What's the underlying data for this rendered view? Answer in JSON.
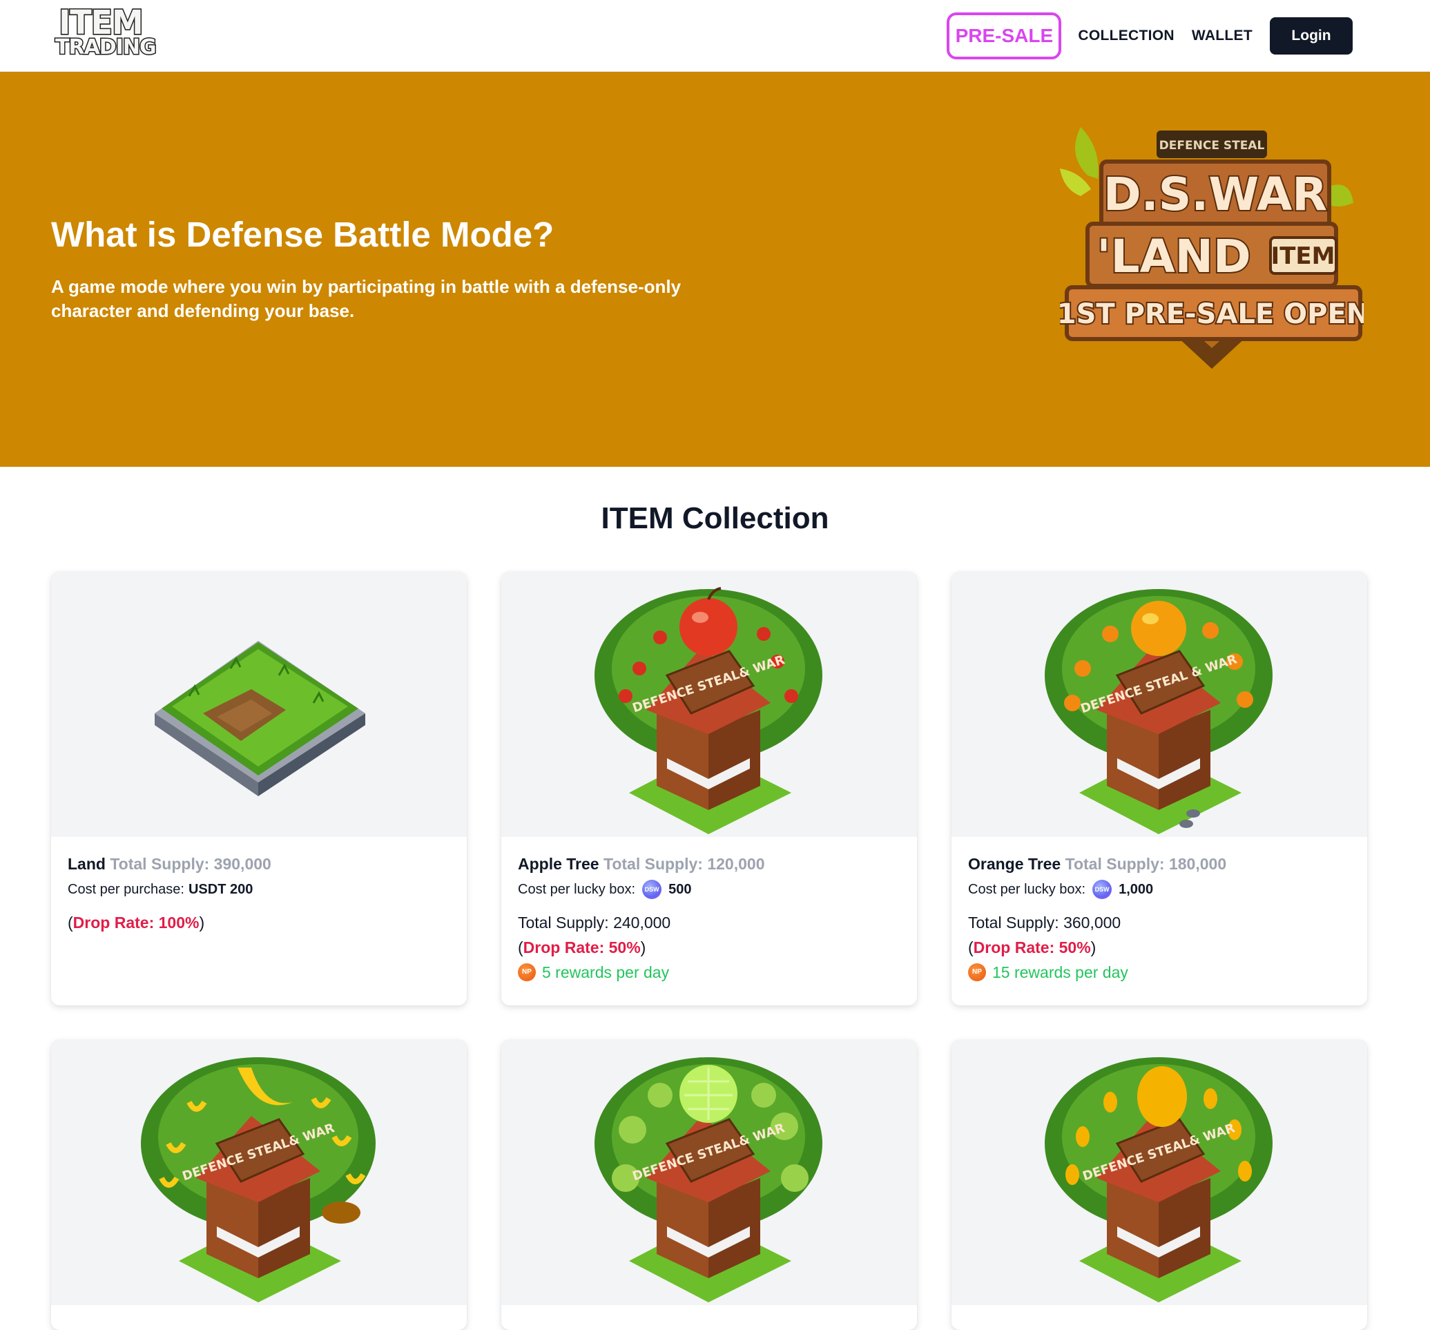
{
  "header": {
    "logo_line1": "ITEM",
    "logo_line2": "TRADING",
    "presale_label": "PRE-SALE",
    "nav_collection": "COLLECTION",
    "nav_wallet": "WALLET",
    "login_label": "Login"
  },
  "hero": {
    "title": "What is Defense Battle Mode?",
    "subtitle": "A game mode where you win by participating in battle with a defense-only character and defending your base.",
    "badge_top": "DEFENCE STEAL",
    "badge_line1": "D.S.WAR",
    "badge_line2": "'LAND",
    "badge_item": "ITEM",
    "badge_line3": "1ST PRE-SALE OPEN",
    "background_color": "#cd8700"
  },
  "collection": {
    "title": "ITEM Collection",
    "cards": [
      {
        "name": "Land",
        "supply": "Total Supply: 390,000",
        "cost_label": "Cost per purchase:",
        "cost_value": "USDT 200",
        "drop_open": "(",
        "drop_text": "Drop Rate: 100%",
        "drop_close": ")",
        "icon": "land-tile-icon"
      },
      {
        "name": "Apple Tree",
        "supply": "Total Supply: 120,000",
        "cost_label": "Cost per lucky box:",
        "coin_label": "DSW",
        "cost_value": "500",
        "total_supply": "Total Supply: 240,000",
        "drop_open": "(",
        "drop_text": "Drop Rate: 50%",
        "drop_close": ")",
        "np_label": "NP",
        "reward": "5 rewards per day",
        "shop_sign": "DEFENCE STEAL& WAR",
        "icon": "apple-tree-shop-icon"
      },
      {
        "name": "Orange Tree",
        "supply": "Total Supply: 180,000",
        "cost_label": "Cost per lucky box:",
        "coin_label": "DSW",
        "cost_value": "1,000",
        "total_supply": "Total Supply: 360,000",
        "drop_open": "(",
        "drop_text": "Drop Rate: 50%",
        "drop_close": ")",
        "np_label": "NP",
        "reward": "15 rewards per day",
        "shop_sign": "DEFENCE STEAL & WAR",
        "icon": "orange-tree-shop-icon"
      },
      {
        "shop_sign": "DEFENCE STEAL& WAR",
        "icon": "banana-tree-shop-icon"
      },
      {
        "shop_sign": "DEFENCE STEAL& WAR",
        "icon": "melon-tree-shop-icon"
      },
      {
        "shop_sign": "DEFENCE STEAL& WAR",
        "icon": "mango-tree-shop-icon"
      }
    ]
  },
  "colors": {
    "accent_presale": "#d946ef",
    "login_bg": "#111827",
    "drop_rate": "#e11d48",
    "reward": "#22c55e"
  }
}
